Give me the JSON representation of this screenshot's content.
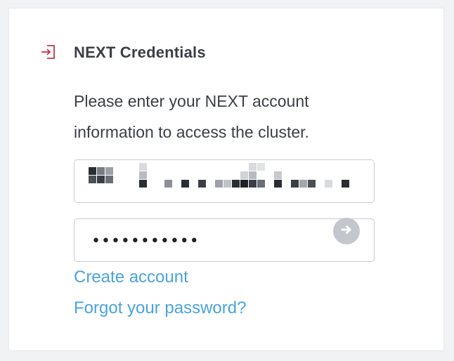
{
  "header": {
    "icon": "login-icon",
    "title": "NEXT Credentials"
  },
  "description": "Please enter your NEXT account information to access the cluster.",
  "username_field": {
    "value_display": "pixelated"
  },
  "password_field": {
    "value_display": "•••••••••••",
    "submit_icon": "arrow-right-icon"
  },
  "links": {
    "create_account": "Create account",
    "forgot_password": "Forgot your password?"
  },
  "colors": {
    "icon_red": "#c0394b",
    "link_blue": "#4aa3df",
    "text": "#3b3f45",
    "border": "#c7cbd1",
    "submit_bg": "#c3c7cd"
  }
}
